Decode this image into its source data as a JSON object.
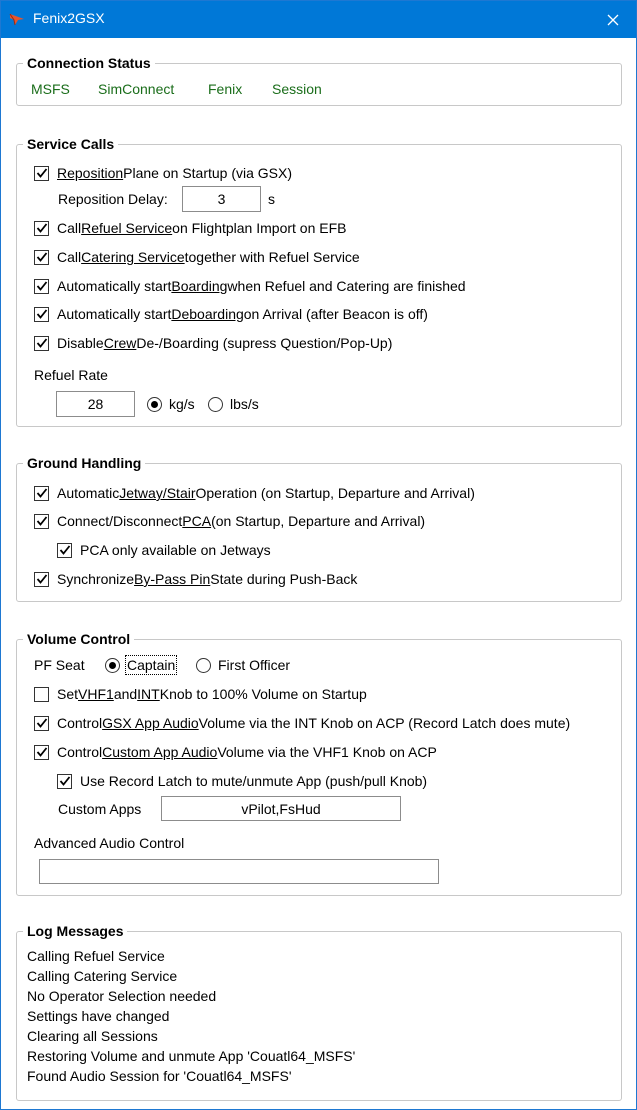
{
  "window": {
    "title": "Fenix2GSX"
  },
  "connection": {
    "legend": "Connection Status",
    "items": [
      "MSFS",
      "SimConnect",
      "Fenix",
      "Session"
    ],
    "color": "#1a6d1a"
  },
  "service": {
    "legend": "Service Calls",
    "reposition": {
      "pre": "",
      "link": "Reposition",
      "post": " Plane on Startup (via GSX)",
      "checked": true
    },
    "reposition_delay_label": "Reposition Delay:",
    "reposition_delay_value": "3",
    "reposition_delay_unit": "s",
    "refuel": {
      "pre": "Call ",
      "link": "Refuel Service",
      "post": " on Flightplan Import on EFB",
      "checked": true
    },
    "catering": {
      "pre": "Call ",
      "link": "Catering Service",
      "post": " together with Refuel Service",
      "checked": true
    },
    "boarding": {
      "pre": "Automatically start ",
      "link": "Boarding",
      "post": " when Refuel and Catering are finished",
      "checked": true
    },
    "deboarding": {
      "pre": "Automatically start ",
      "link": "Deboarding",
      "post": " on Arrival (after Beacon is off)",
      "checked": true
    },
    "crew": {
      "pre": "Disable ",
      "link": "Crew",
      "post": " De-/Boarding (supress Question/Pop-Up)",
      "checked": true
    },
    "refuel_rate_label": "Refuel Rate",
    "refuel_rate_value": "28",
    "unit_kg": "kg/s",
    "unit_lbs": "lbs/s",
    "selected_unit": "kg/s"
  },
  "ground": {
    "legend": "Ground Handling",
    "jetway": {
      "pre": "Automatic ",
      "link": "Jetway/Stair",
      "post": " Operation (on Startup, Departure and Arrival)",
      "checked": true
    },
    "pca": {
      "pre": "Connect/Disconnect ",
      "link": "PCA",
      "post": " (on Startup, Departure and Arrival)",
      "checked": true
    },
    "pca_jetways": {
      "label": "PCA only available on Jetways",
      "checked": true
    },
    "bypass": {
      "pre": "Synchronize ",
      "link": "By-Pass Pin",
      "post": " State during Push-Back",
      "checked": true
    }
  },
  "volume": {
    "legend": "Volume Control",
    "pf_seat_label": "PF Seat",
    "captain": "Captain",
    "first_officer": "First Officer",
    "selected_seat": "Captain",
    "vhf1": {
      "pre": "Set ",
      "link1": "VHF1",
      "mid": " and ",
      "link2": "INT",
      "post": " Knob to 100% Volume on Startup",
      "checked": false
    },
    "gsx_audio": {
      "pre": "Control ",
      "link": "GSX App Audio",
      "post": " Volume via the INT Knob on ACP (Record Latch does mute)",
      "checked": true
    },
    "custom_audio": {
      "pre": "Control ",
      "link": "Custom App Audio",
      "post": " Volume via the VHF1 Knob on ACP",
      "checked": true
    },
    "record_latch": {
      "label": "Use Record Latch to mute/unmute App (push/pull Knob)",
      "checked": true
    },
    "custom_apps_label": "Custom Apps",
    "custom_apps_value": "vPilot,FsHud",
    "advanced_label": "Advanced Audio Control",
    "advanced_value": ""
  },
  "log": {
    "legend": "Log Messages",
    "lines": [
      "Calling Refuel Service",
      "Calling Catering Service",
      "No Operator Selection needed",
      "Settings have changed",
      "Clearing all Sessions",
      "Restoring Volume and unmute App 'Couatl64_MSFS'",
      "Found Audio Session for 'Couatl64_MSFS'"
    ]
  },
  "icons": {
    "app": "plane-logo-icon",
    "close": "close-icon",
    "check": "checkmark-icon"
  }
}
